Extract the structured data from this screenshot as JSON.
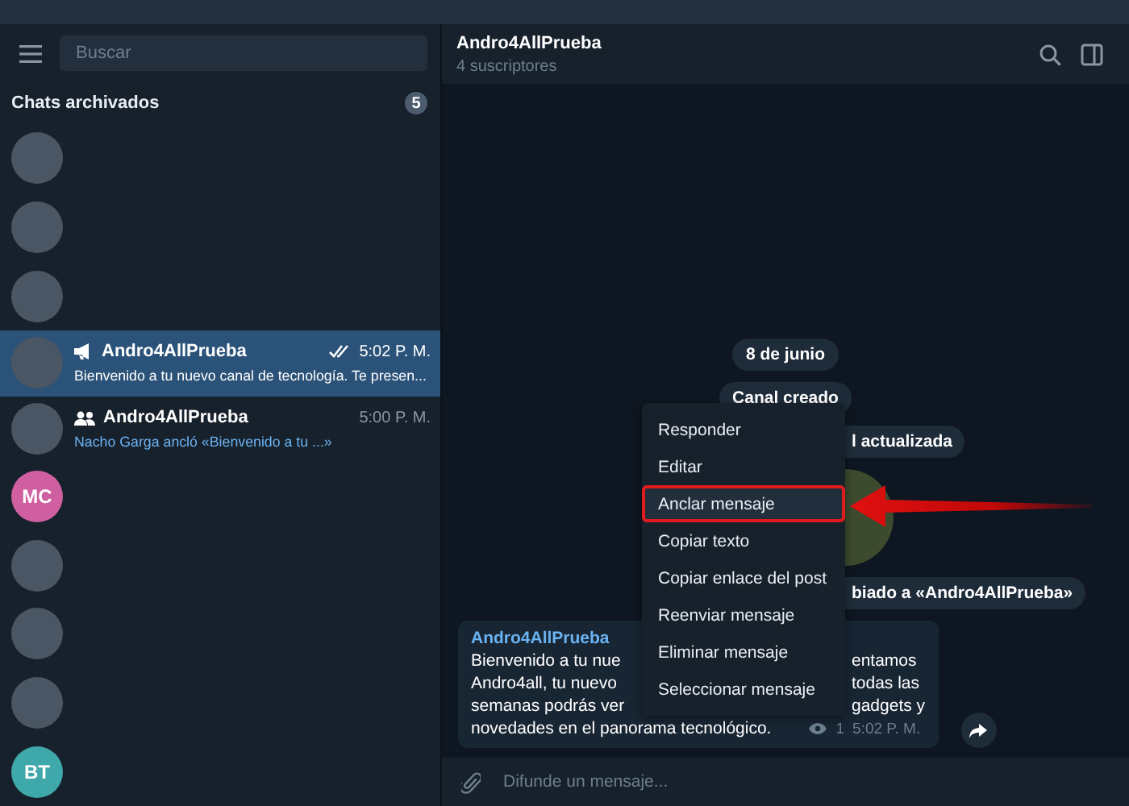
{
  "sidebar": {
    "search": {
      "placeholder": "Buscar"
    },
    "archived": {
      "title": "Chats archivados",
      "count": "5"
    },
    "items": [
      {
        "kind": "photo",
        "selected": false
      },
      {
        "kind": "photo",
        "selected": false
      },
      {
        "kind": "photo",
        "selected": false
      },
      {
        "kind": "chat",
        "channel": true,
        "name": "Andro4AllPrueba",
        "time": "5:02 P. M.",
        "read": true,
        "preview": "Bienvenido a tu nuevo canal de tecnología. Te presen...",
        "selected": true
      },
      {
        "kind": "chat",
        "channel": false,
        "name": "Andro4AllPrueba",
        "time": "5:00 P. M.",
        "read": false,
        "preview": "Nacho Garga ancló «Bienvenido a tu ...»",
        "selected": false
      },
      {
        "kind": "initials",
        "initials": "MC",
        "color": "#d05fa1",
        "selected": false
      },
      {
        "kind": "photo",
        "selected": false
      },
      {
        "kind": "photo",
        "selected": false
      },
      {
        "kind": "photo",
        "selected": false
      },
      {
        "kind": "initials",
        "initials": "BT",
        "color": "#3fa8aa",
        "selected": false
      }
    ]
  },
  "chat": {
    "title": "Andro4AllPrueba",
    "subtitle": "4 suscriptores",
    "services": [
      {
        "kind": "full",
        "text": "8 de junio"
      },
      {
        "kind": "full",
        "text": "Canal creado"
      },
      {
        "kind": "partial",
        "text": "l actualizada"
      },
      {
        "kind": "photo"
      },
      {
        "kind": "partial",
        "text": "biado a «Andro4AllPrueba»"
      }
    ],
    "message": {
      "sender": "Andro4AllPrueba",
      "split_lines": [
        {
          "left": "Bienvenido a tu nue",
          "right": "entamos"
        },
        {
          "left": "Andro4all, tu nuevo",
          "right": "todas las"
        },
        {
          "left": "semanas podrás ver",
          "right": "gadgets y"
        }
      ],
      "last_line": "novedades en el panorama tecnológico.",
      "views": "1",
      "time": "5:02 P. M."
    },
    "composer": {
      "placeholder": "Difunde un mensaje..."
    }
  },
  "context_menu": {
    "items": [
      {
        "label": "Responder",
        "selected": false
      },
      {
        "label": "Editar",
        "selected": false
      },
      {
        "label": "Anclar mensaje",
        "selected": true
      },
      {
        "label": "Copiar texto",
        "selected": false
      },
      {
        "label": "Copiar enlace del post",
        "selected": false
      },
      {
        "label": "Reenviar mensaje",
        "selected": false
      },
      {
        "label": "Eliminar mensaje",
        "selected": false
      },
      {
        "label": "Seleccionar mensaje",
        "selected": false
      }
    ]
  }
}
